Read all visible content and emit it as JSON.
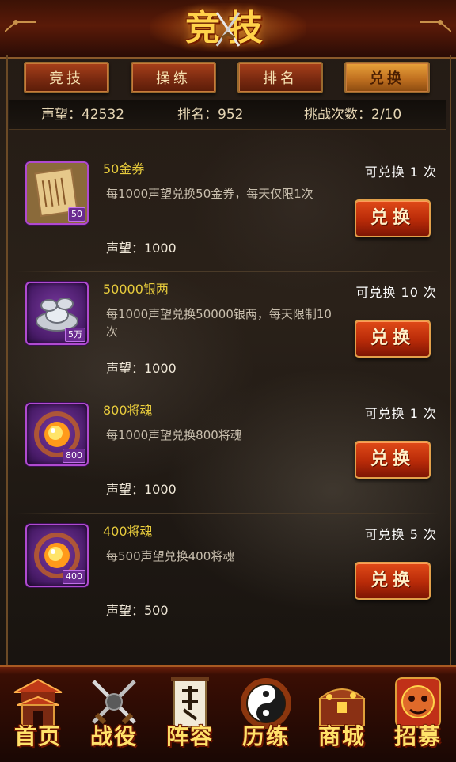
{
  "header": {
    "title": "竞技"
  },
  "tabs": [
    {
      "label": "竞技",
      "active": false
    },
    {
      "label": "操练",
      "active": false
    },
    {
      "label": "排名",
      "active": false
    },
    {
      "label": "兑换",
      "active": true
    }
  ],
  "stats": {
    "prestige": "声望：42532",
    "rank": "排名：952",
    "challenges": "挑战次数：2/10"
  },
  "items": [
    {
      "name": "50金券",
      "desc": "每1000声望兑换50金券，每天仅限1次",
      "cost": "声望：1000",
      "limit": "可兑换 1 次",
      "badge": "50",
      "icon": "gold-voucher-icon",
      "button": "兑换"
    },
    {
      "name": "50000银两",
      "desc": "每1000声望兑换50000银两，每天限制10次",
      "cost": "声望：1000",
      "limit": "可兑换 10 次",
      "badge": "5万",
      "icon": "silver-ingot-icon",
      "button": "兑换"
    },
    {
      "name": "800将魂",
      "desc": "每1000声望兑换800将魂",
      "cost": "声望：1000",
      "limit": "可兑换 1 次",
      "badge": "800",
      "icon": "general-soul-icon",
      "button": "兑换"
    },
    {
      "name": "400将魂",
      "desc": "每500声望兑换400将魂",
      "cost": "声望：500",
      "limit": "可兑换 5 次",
      "badge": "400",
      "icon": "general-soul-icon",
      "button": "兑换"
    }
  ],
  "bottom_nav": [
    {
      "label": "首页",
      "icon": "palace-icon"
    },
    {
      "label": "战役",
      "icon": "crossed-swords-icon"
    },
    {
      "label": "阵容",
      "icon": "banner-icon"
    },
    {
      "label": "历练",
      "icon": "yin-yang-icon"
    },
    {
      "label": "商城",
      "icon": "treasure-chest-icon"
    },
    {
      "label": "招募",
      "icon": "lion-mask-icon"
    }
  ],
  "colors": {
    "accent_gold": "#e8cc3c",
    "button_red": "#b82a08",
    "icon_frame_purple": "#b04ad0"
  }
}
